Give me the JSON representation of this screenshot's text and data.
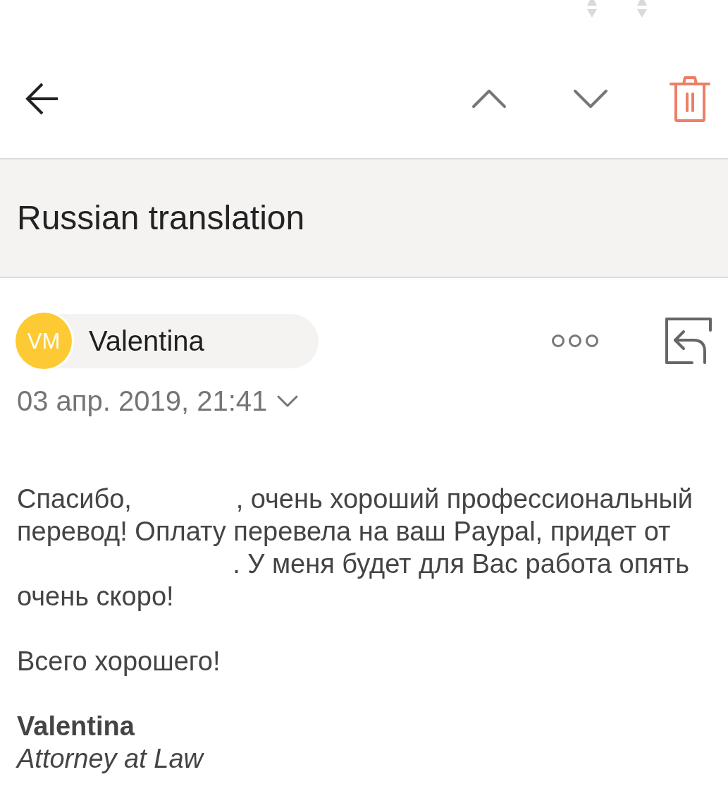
{
  "subject": "Russian translation",
  "sender": {
    "initials": "VM",
    "name": "Valentina"
  },
  "date": {
    "text": "03 апр. 2019, 21:41",
    "expanded": false
  },
  "body": {
    "paragraphs": [
      "Спасибо,              , очень хороший профессиональный перевод! Оплату перевела на ваш Paypal, придет от                              . У меня будет для Вас работа опять очень скоро!",
      "Всего хорошего!"
    ],
    "signature": {
      "name": "Valentina",
      "title": "Attorney at Law"
    }
  }
}
